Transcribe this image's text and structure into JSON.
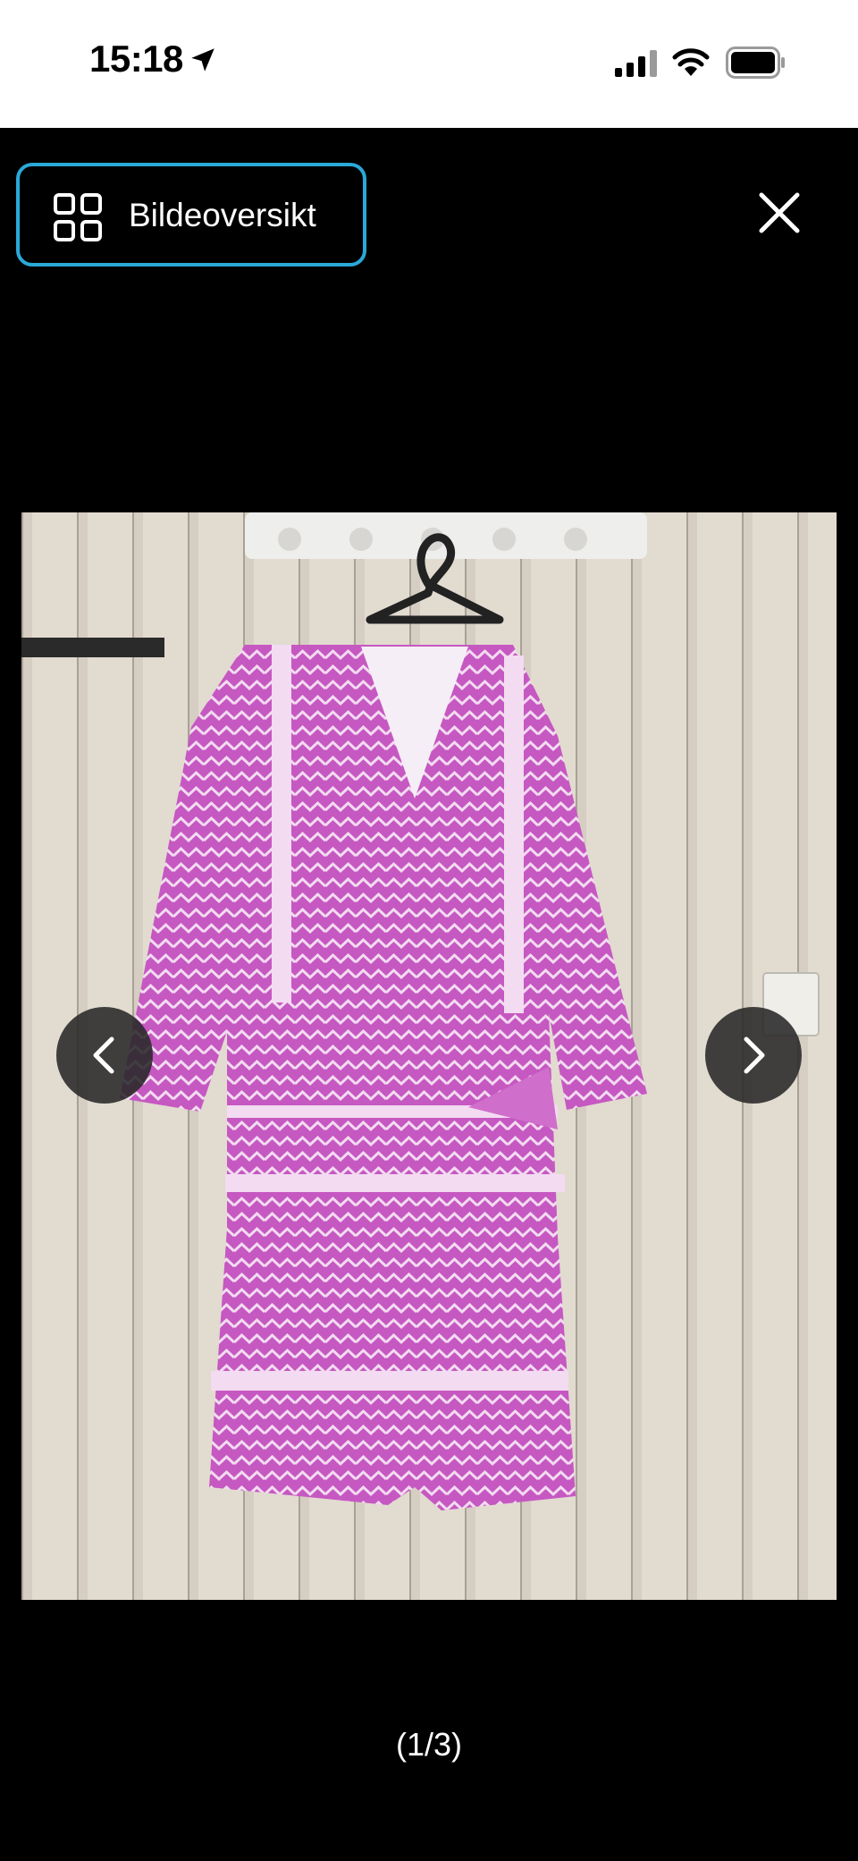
{
  "status_bar": {
    "time": "15:18",
    "icons": [
      "location-arrow-icon",
      "cellular-signal-icon",
      "wifi-icon",
      "battery-icon"
    ]
  },
  "header": {
    "overview_label": "Bildeoversikt",
    "overview_icon": "grid-icon",
    "close_icon": "close-icon",
    "accent_color": "#2aa8d8"
  },
  "image": {
    "subject": "product-photo",
    "nav_prev_icon": "chevron-left-icon",
    "nav_next_icon": "chevron-right-icon"
  },
  "pager": {
    "counter": "(1/3)"
  }
}
